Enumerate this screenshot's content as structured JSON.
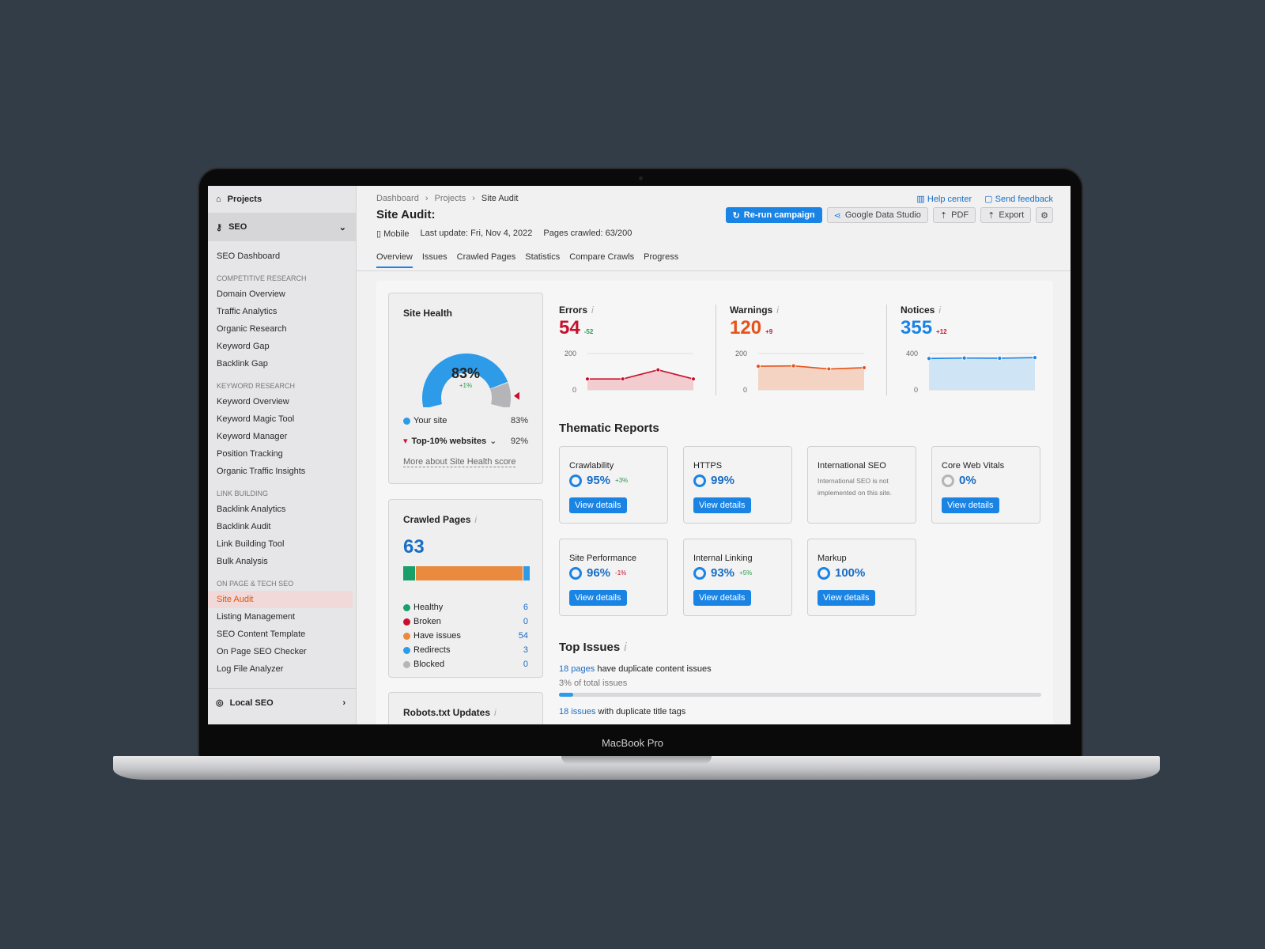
{
  "device_label": "MacBook Pro",
  "colors": {
    "accent": "#1a84e5",
    "errors": "#c8102e",
    "warnings": "#e5531a",
    "notices": "#1a84e5",
    "healthy": "#19a06a",
    "broken": "#c8102e",
    "have_issues": "#ea8a3e",
    "redirects": "#2d9be8",
    "blocked": "#b5b5b8"
  },
  "sidebar": {
    "projects": "Projects",
    "seo": "SEO",
    "seo_dashboard": "SEO Dashboard",
    "groups": [
      {
        "heading": "COMPETITIVE RESEARCH",
        "items": [
          "Domain Overview",
          "Traffic Analytics",
          "Organic Research",
          "Keyword Gap",
          "Backlink Gap"
        ]
      },
      {
        "heading": "KEYWORD RESEARCH",
        "items": [
          "Keyword Overview",
          "Keyword Magic Tool",
          "Keyword Manager",
          "Position Tracking",
          "Organic Traffic Insights"
        ]
      },
      {
        "heading": "LINK BUILDING",
        "items": [
          "Backlink Analytics",
          "Backlink Audit",
          "Link Building Tool",
          "Bulk Analysis"
        ]
      },
      {
        "heading": "ON PAGE & TECH SEO",
        "items": [
          "Site Audit",
          "Listing Management",
          "SEO Content Template",
          "On Page SEO Checker",
          "Log File Analyzer"
        ]
      }
    ],
    "active": "Site Audit",
    "local_seo": "Local SEO"
  },
  "header": {
    "breadcrumb": [
      "Dashboard",
      "Projects",
      "Site Audit"
    ],
    "title": "Site Audit:",
    "device": "Mobile",
    "last_update": "Last update: Fri, Nov 4, 2022",
    "pages_crawled": "Pages crawled: 63/200",
    "help": "Help center",
    "feedback": "Send feedback",
    "rerun": "Re-run campaign",
    "gds": "Google Data Studio",
    "pdf": "PDF",
    "export": "Export",
    "tabs": [
      "Overview",
      "Issues",
      "Crawled Pages",
      "Statistics",
      "Compare Crawls",
      "Progress"
    ]
  },
  "site_health": {
    "title": "Site Health",
    "score": 83,
    "score_label": "83%",
    "delta": "+1%",
    "your_site": "Your site",
    "your_val": "83%",
    "top10": "Top-10% websites",
    "top10_val": "92%",
    "top10_score": 92,
    "more": "More about Site Health score"
  },
  "crawled": {
    "title": "Crawled Pages",
    "total": "63",
    "items": [
      {
        "label": "Healthy",
        "value": 6,
        "key": "healthy"
      },
      {
        "label": "Broken",
        "value": 0,
        "key": "broken"
      },
      {
        "label": "Have issues",
        "value": 54,
        "key": "have_issues"
      },
      {
        "label": "Redirects",
        "value": 3,
        "key": "redirects"
      },
      {
        "label": "Blocked",
        "value": 0,
        "key": "blocked"
      }
    ]
  },
  "robots": {
    "title": "Robots.txt Updates"
  },
  "metrics": [
    {
      "label": "Errors",
      "value": "54",
      "delta": "-52",
      "color": "#c8102e",
      "fill": "#f2cccf",
      "ymax": 200,
      "ticks": [
        "200",
        "0"
      ],
      "values": [
        60,
        60,
        110,
        60
      ]
    },
    {
      "label": "Warnings",
      "value": "120",
      "delta": "+9",
      "color": "#e5531a",
      "fill": "#f4d3c3",
      "ymax": 200,
      "ticks": [
        "200",
        "0"
      ],
      "values": [
        130,
        132,
        115,
        122
      ]
    },
    {
      "label": "Notices",
      "value": "355",
      "delta": "+12",
      "color": "#1a84e5",
      "fill": "#cfe4f5",
      "ymax": 400,
      "ticks": [
        "400",
        "0"
      ],
      "values": [
        345,
        350,
        348,
        355
      ]
    }
  ],
  "thematic": {
    "title": "Thematic Reports",
    "view": "View details",
    "cards": [
      {
        "name": "Crawlability",
        "pct": "95%",
        "delta": "+3%",
        "dir": "up"
      },
      {
        "name": "HTTPS",
        "pct": "99%",
        "delta": "",
        "dir": ""
      },
      {
        "name": "International SEO",
        "note": "International SEO is not implemented on this site."
      },
      {
        "name": "Core Web Vitals",
        "pct": "0%",
        "delta": "",
        "dir": "",
        "zero": true
      },
      {
        "name": "Site Performance",
        "pct": "96%",
        "delta": "-1%",
        "dir": "dn"
      },
      {
        "name": "Internal Linking",
        "pct": "93%",
        "delta": "+5%",
        "dir": "up"
      },
      {
        "name": "Markup",
        "pct": "100%",
        "delta": "",
        "dir": ""
      }
    ]
  },
  "top_issues": {
    "title": "Top Issues",
    "items": [
      {
        "link": "18 pages",
        "text": " have duplicate content issues",
        "sub": "3% of total issues",
        "progress": 3
      },
      {
        "link": "18 issues",
        "text": " with duplicate title tags"
      }
    ]
  }
}
